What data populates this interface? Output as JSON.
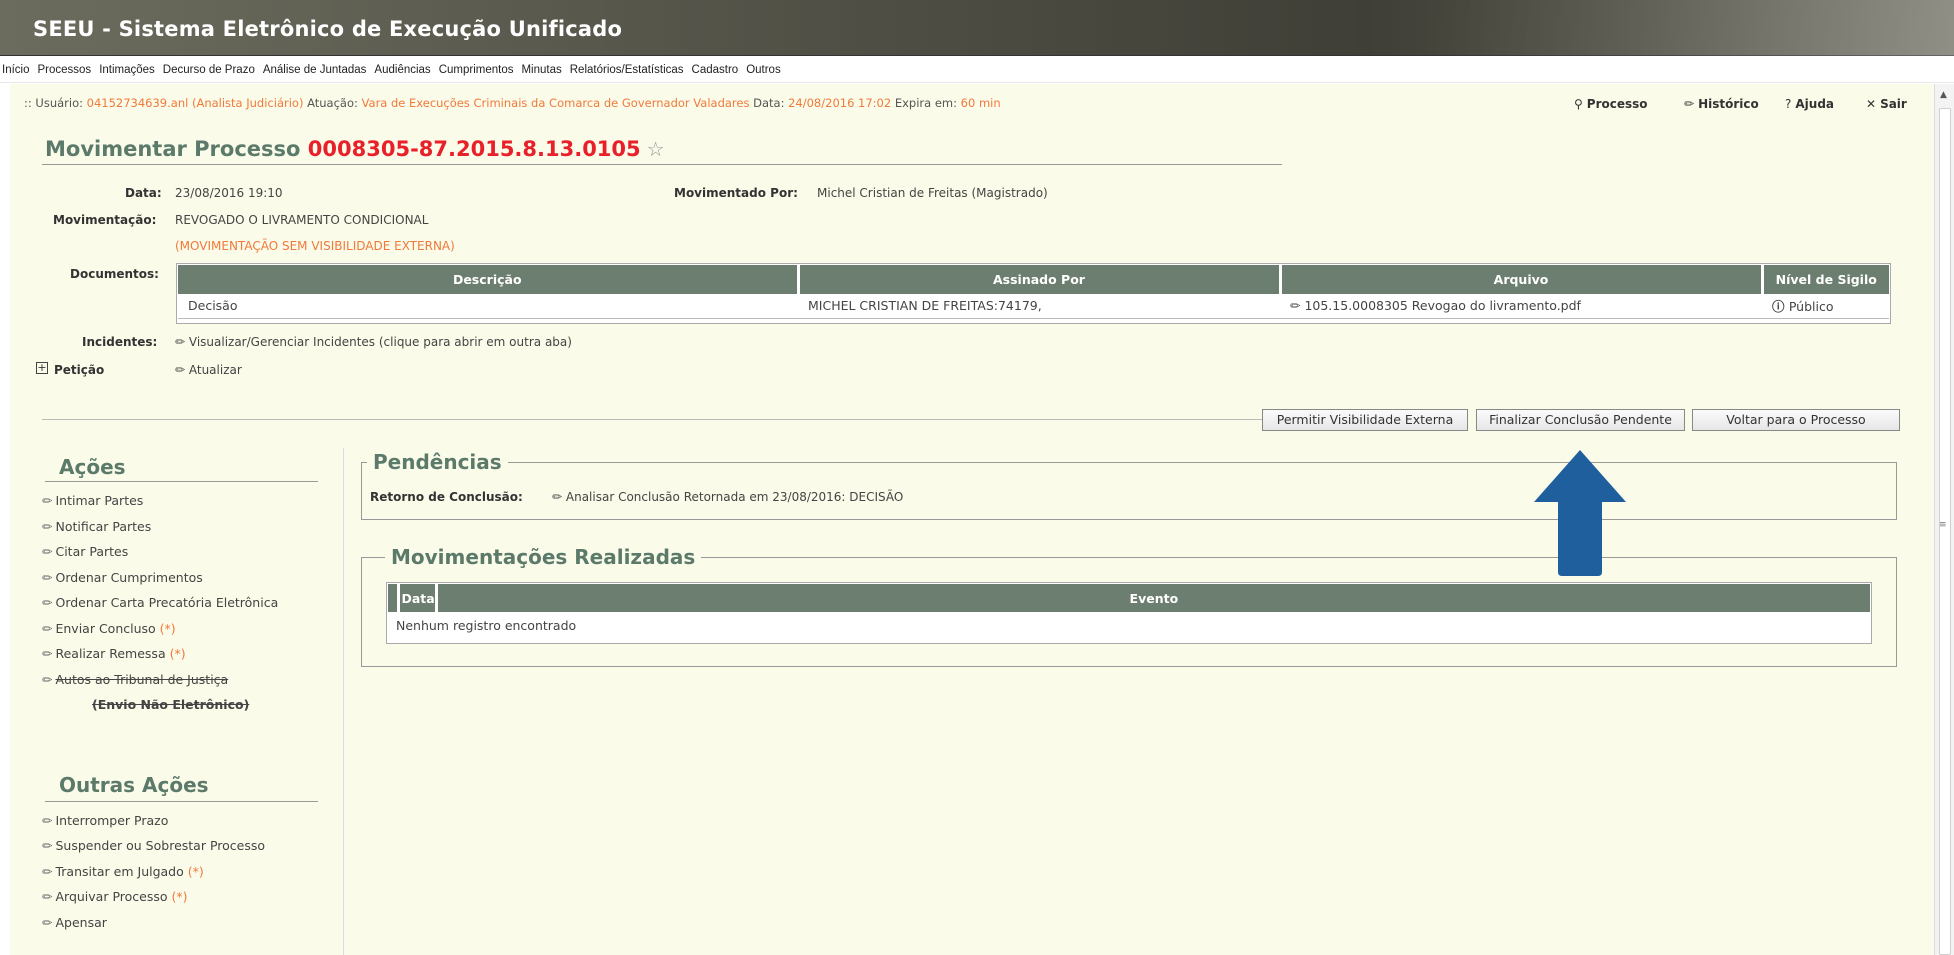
{
  "header": {
    "title": "SEEU - Sistema Eletrônico de Execução Unificado"
  },
  "menu": [
    "Início",
    "Processos",
    "Intimações",
    "Decurso de Prazo",
    "Análise de Juntadas",
    "Audiências",
    "Cumprimentos",
    "Minutas",
    "Relatórios/Estatísticas",
    "Cadastro",
    "Outros"
  ],
  "userbar": {
    "prefix": ":: Usuário: ",
    "user": "04152734639.anl (Analista Judiciário)",
    "atuacao_label": " Atuação: ",
    "atuacao": "Vara de Execuções Criminais da Comarca de Governador Valadares",
    "data_label": " Data: ",
    "data": "24/08/2016 17:02",
    "expira_label": " Expira em: ",
    "expira": "60 min"
  },
  "toplinks": {
    "processo": "Processo",
    "historico": "Histórico",
    "ajuda": "Ajuda",
    "sair": "Sair"
  },
  "page": {
    "title_prefix": "Movimentar Processo ",
    "process_number": "0008305-87.2015.8.13.0105"
  },
  "details": {
    "data_label": "Data:",
    "data_value": "23/08/2016 19:10",
    "movimentado_label": "Movimentado Por:",
    "movimentado_value": "Michel Cristian de Freitas (Magistrado)",
    "movimentacao_label": "Movimentação:",
    "movimentacao_value": "REVOGADO O LIVRAMENTO CONDICIONAL",
    "movimentacao_note": "(MOVIMENTAÇÃO SEM VISIBILIDADE EXTERNA)",
    "documentos_label": "Documentos:",
    "incidentes_label": "Incidentes:",
    "incidentes_value": "Visualizar/Gerenciar Incidentes (clique para abrir em outra aba)",
    "peticao_label": "Petição",
    "peticao_value": "Atualizar"
  },
  "documents": {
    "headers": [
      "Descrição",
      "Assinado Por",
      "Arquivo",
      "Nível de Sigilo"
    ],
    "rows": [
      {
        "descricao": "Decisão",
        "assinado": "MICHEL CRISTIAN DE FREITAS:74179,",
        "arquivo": "105.15.0008305 Revogao do livramento.pdf",
        "sigilo": "Público"
      }
    ]
  },
  "buttons": {
    "permitir": "Permitir Visibilidade Externa",
    "finalizar": "Finalizar Conclusão Pendente",
    "voltar": "Voltar para o Processo"
  },
  "acoes": {
    "title": "Ações",
    "items": [
      "Intimar Partes",
      "Notificar Partes",
      "Citar Partes",
      "Ordenar Cumprimentos",
      "Ordenar Carta Precatória Eletrônica",
      "Enviar Concluso",
      "Realizar Remessa",
      "Autos ao Tribunal de Justiça"
    ],
    "required_mark": "(*)",
    "envio_note": "(Envio Não Eletrônico)"
  },
  "outras_acoes": {
    "title": "Outras Ações",
    "items": [
      "Interromper Prazo",
      "Suspender ou Sobrestar Processo",
      "Transitar em Julgado",
      "Arquivar Processo",
      "Apensar"
    ]
  },
  "pendencias": {
    "title": "Pendências",
    "retorno_label": "Retorno de Conclusão:",
    "retorno_value": "Analisar Conclusão Retornada em 23/08/2016: DECISÃO"
  },
  "movimentacoes": {
    "title": "Movimentações Realizadas",
    "headers": [
      "Data",
      "Evento"
    ],
    "empty": "Nenhum registro encontrado"
  },
  "colors": {
    "accent_green": "#5b7a6a",
    "table_header": "#6c7e6f",
    "orange": "#f07a3a",
    "red": "#e8202a",
    "arrow_blue": "#1f5f9e"
  }
}
